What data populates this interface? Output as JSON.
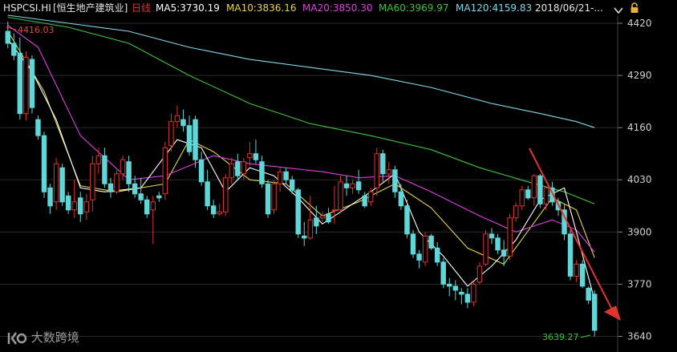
{
  "header": {
    "symbol": "HSPCSI.HI",
    "name": "[恒生地产建筑业]",
    "period": "日线",
    "ma": [
      {
        "label": "MA5:3730.19",
        "color": "#ffffff"
      },
      {
        "label": "MA10:3836.16",
        "color": "#e8d44d"
      },
      {
        "label": "MA20:3850.30",
        "color": "#e040e0"
      },
      {
        "label": "MA60:3969.97",
        "color": "#3ec23e"
      },
      {
        "label": "MA120:4159.83",
        "color": "#7fd8e8"
      }
    ],
    "date": "2018/06/21-..."
  },
  "colors": {
    "up": "#e0342e",
    "down": "#5fd7d8",
    "grid": "#2a2a2a",
    "axis_text": "#cfcfcf",
    "arrow": "#e0342e",
    "period": "#e0342e",
    "symbol": "#e6e6e6"
  },
  "icons": {
    "dropdown": "chevron-down-icon",
    "lock": "lock-icon"
  },
  "watermark": {
    "text": "大数跨境"
  },
  "chart_data": {
    "type": "candlestick",
    "y_ticks": [
      4420,
      4290,
      4160,
      4030,
      3900,
      3770,
      3640
    ],
    "ylim": [
      3615,
      4442
    ],
    "grid": true,
    "annotations": {
      "max_label": "4416.03",
      "min_label": "3639.27",
      "max_value": 4416.03,
      "min_value": 3639.27
    },
    "candles": [
      [
        4400,
        4424,
        4358,
        4370
      ],
      [
        4370,
        4395,
        4328,
        4340
      ],
      [
        4345,
        4385,
        4180,
        4195
      ],
      [
        4195,
        4350,
        4178,
        4335
      ],
      [
        4330,
        4340,
        4195,
        4210
      ],
      [
        4180,
        4190,
        4130,
        4140
      ],
      [
        4140,
        4150,
        3985,
        4000
      ],
      [
        4010,
        4020,
        3945,
        3965
      ],
      [
        3975,
        4085,
        3955,
        4070
      ],
      [
        4060,
        4070,
        3965,
        3975
      ],
      [
        3990,
        4000,
        3945,
        3955
      ],
      [
        3955,
        4030,
        3935,
        3975
      ],
      [
        3985,
        4000,
        3925,
        3945
      ],
      [
        3950,
        3995,
        3930,
        3975
      ],
      [
        3980,
        4090,
        3950,
        4070
      ],
      [
        4070,
        4110,
        4045,
        4090
      ],
      [
        4090,
        4110,
        4010,
        4020
      ],
      [
        4020,
        4035,
        3985,
        4000
      ],
      [
        4000,
        4055,
        3995,
        4045
      ],
      [
        4045,
        4090,
        4030,
        4080
      ],
      [
        4075,
        4090,
        4000,
        4020
      ],
      [
        4020,
        4040,
        3985,
        3995
      ],
      [
        3995,
        4035,
        3970,
        3980
      ],
      [
        3980,
        3990,
        3935,
        3945
      ],
      [
        3955,
        3990,
        3870,
        3975
      ],
      [
        3990,
        4000,
        3975,
        3985
      ],
      [
        3995,
        4125,
        3980,
        4110
      ],
      [
        4115,
        4195,
        4100,
        4175
      ],
      [
        4175,
        4215,
        4160,
        4190
      ],
      [
        4180,
        4205,
        4150,
        4165
      ],
      [
        4165,
        4190,
        4090,
        4100
      ],
      [
        4180,
        4190,
        4060,
        4080
      ],
      [
        4080,
        4100,
        4015,
        4025
      ],
      [
        4025,
        4055,
        3955,
        3965
      ],
      [
        3965,
        3980,
        3935,
        3945
      ],
      [
        3945,
        3970,
        3940,
        3950
      ],
      [
        3950,
        4045,
        3940,
        4035
      ],
      [
        4035,
        4085,
        4020,
        4070
      ],
      [
        4075,
        4095,
        4030,
        4040
      ],
      [
        4045,
        4085,
        4030,
        4075
      ],
      [
        4085,
        4125,
        4065,
        4095
      ],
      [
        4095,
        4130,
        4070,
        4080
      ],
      [
        4075,
        4090,
        4010,
        4020
      ],
      [
        4020,
        4030,
        3935,
        3945
      ],
      [
        3955,
        4030,
        3945,
        4020
      ],
      [
        4020,
        4060,
        4000,
        4050
      ],
      [
        4050,
        4060,
        4020,
        4030
      ],
      [
        4030,
        4040,
        3995,
        4005
      ],
      [
        4005,
        4010,
        3885,
        3895
      ],
      [
        3890,
        3925,
        3865,
        3885
      ],
      [
        3885,
        3990,
        3880,
        3930
      ],
      [
        3935,
        3965,
        3895,
        3915
      ],
      [
        3935,
        3950,
        3925,
        3940
      ],
      [
        3945,
        3960,
        3920,
        3925
      ],
      [
        3955,
        4015,
        3920,
        3955
      ],
      [
        3955,
        4040,
        3950,
        4025
      ],
      [
        4020,
        4040,
        3990,
        4010
      ],
      [
        4010,
        4030,
        3995,
        4020
      ],
      [
        4025,
        4055,
        3995,
        4005
      ],
      [
        3990,
        4000,
        3960,
        3965
      ],
      [
        3975,
        4010,
        3965,
        4000
      ],
      [
        4010,
        4110,
        3990,
        4095
      ],
      [
        4095,
        4105,
        4025,
        4045
      ],
      [
        4045,
        4075,
        4020,
        4055
      ],
      [
        4055,
        4065,
        3985,
        4000
      ],
      [
        4000,
        4020,
        3955,
        3965
      ],
      [
        3965,
        3980,
        3885,
        3895
      ],
      [
        3895,
        3905,
        3835,
        3845
      ],
      [
        3845,
        3855,
        3810,
        3830
      ],
      [
        3825,
        3900,
        3815,
        3890
      ],
      [
        3890,
        3895,
        3855,
        3860
      ],
      [
        3860,
        3875,
        3815,
        3825
      ],
      [
        3825,
        3835,
        3760,
        3770
      ],
      [
        3770,
        3785,
        3740,
        3765
      ],
      [
        3765,
        3780,
        3730,
        3755
      ],
      [
        3750,
        3760,
        3720,
        3745
      ],
      [
        3745,
        3760,
        3710,
        3725
      ],
      [
        3725,
        3775,
        3715,
        3770
      ],
      [
        3775,
        3825,
        3770,
        3815
      ],
      [
        3820,
        3905,
        3815,
        3895
      ],
      [
        3895,
        3910,
        3870,
        3885
      ],
      [
        3885,
        3895,
        3845,
        3855
      ],
      [
        3855,
        3880,
        3815,
        3840
      ],
      [
        3840,
        3945,
        3830,
        3935
      ],
      [
        3935,
        3975,
        3925,
        3965
      ],
      [
        3965,
        4015,
        3955,
        4005
      ],
      [
        4005,
        4015,
        3980,
        3985
      ],
      [
        3985,
        4045,
        3965,
        4040
      ],
      [
        4040,
        4045,
        3960,
        3970
      ],
      [
        3970,
        4015,
        3955,
        4010
      ],
      [
        4010,
        4025,
        3965,
        3975
      ],
      [
        3975,
        3985,
        3940,
        3955
      ],
      [
        3955,
        3970,
        3880,
        3895
      ],
      [
        3895,
        3905,
        3780,
        3790
      ],
      [
        3790,
        3830,
        3775,
        3820
      ],
      [
        3820,
        3830,
        3760,
        3765
      ],
      [
        3760,
        3765,
        3720,
        3730
      ],
      [
        3745,
        3755,
        3640,
        3655
      ]
    ],
    "ma_lines": [
      {
        "name": "MA10",
        "color": "#e8d44d",
        "end": 3836.16,
        "points": [
          [
            0,
            4400
          ],
          [
            6,
            4250
          ],
          [
            12,
            4015
          ],
          [
            18,
            4000
          ],
          [
            26,
            4020
          ],
          [
            30,
            4130
          ],
          [
            34,
            4100
          ],
          [
            40,
            4030
          ],
          [
            46,
            4020
          ],
          [
            52,
            3940
          ],
          [
            58,
            3975
          ],
          [
            64,
            4020
          ],
          [
            70,
            3960
          ],
          [
            76,
            3860
          ],
          [
            82,
            3820
          ],
          [
            90,
            3985
          ],
          [
            94,
            3955
          ],
          [
            97,
            3836
          ]
        ]
      },
      {
        "name": "MA20",
        "color": "#e040e0",
        "end": 3850.3,
        "points": [
          [
            0,
            4415
          ],
          [
            5,
            4360
          ],
          [
            12,
            4140
          ],
          [
            20,
            4030
          ],
          [
            26,
            4040
          ],
          [
            34,
            4090
          ],
          [
            40,
            4070
          ],
          [
            46,
            4060
          ],
          [
            52,
            4050
          ],
          [
            58,
            4035
          ],
          [
            64,
            4040
          ],
          [
            70,
            4000
          ],
          [
            78,
            3940
          ],
          [
            84,
            3900
          ],
          [
            90,
            3930
          ],
          [
            94,
            3905
          ],
          [
            97,
            3850
          ]
        ]
      },
      {
        "name": "MA60",
        "color": "#3ec23e",
        "end": 3969.97,
        "points": [
          [
            0,
            4435
          ],
          [
            10,
            4410
          ],
          [
            20,
            4370
          ],
          [
            30,
            4290
          ],
          [
            40,
            4220
          ],
          [
            50,
            4170
          ],
          [
            60,
            4140
          ],
          [
            70,
            4105
          ],
          [
            78,
            4060
          ],
          [
            86,
            4025
          ],
          [
            92,
            4000
          ],
          [
            97,
            3970
          ]
        ]
      },
      {
        "name": "MA120",
        "color": "#7fd8e8",
        "end": 4159.83,
        "points": [
          [
            0,
            4440
          ],
          [
            10,
            4420
          ],
          [
            20,
            4400
          ],
          [
            30,
            4360
          ],
          [
            40,
            4330
          ],
          [
            50,
            4310
          ],
          [
            60,
            4290
          ],
          [
            70,
            4260
          ],
          [
            80,
            4220
          ],
          [
            88,
            4195
          ],
          [
            94,
            4175
          ],
          [
            97,
            4160
          ]
        ]
      },
      {
        "name": "MA5",
        "color": "#ffffff",
        "end": 3730.19,
        "points": [
          [
            0,
            4380
          ],
          [
            4,
            4300
          ],
          [
            8,
            4180
          ],
          [
            12,
            4010
          ],
          [
            16,
            4000
          ],
          [
            22,
            4010
          ],
          [
            28,
            4130
          ],
          [
            32,
            4110
          ],
          [
            36,
            4000
          ],
          [
            40,
            4060
          ],
          [
            44,
            4040
          ],
          [
            48,
            3985
          ],
          [
            52,
            3920
          ],
          [
            56,
            3960
          ],
          [
            60,
            4000
          ],
          [
            64,
            4045
          ],
          [
            68,
            3900
          ],
          [
            72,
            3840
          ],
          [
            76,
            3765
          ],
          [
            80,
            3815
          ],
          [
            84,
            3880
          ],
          [
            88,
            3980
          ],
          [
            92,
            4010
          ],
          [
            94,
            3900
          ],
          [
            97,
            3730
          ]
        ]
      }
    ]
  }
}
